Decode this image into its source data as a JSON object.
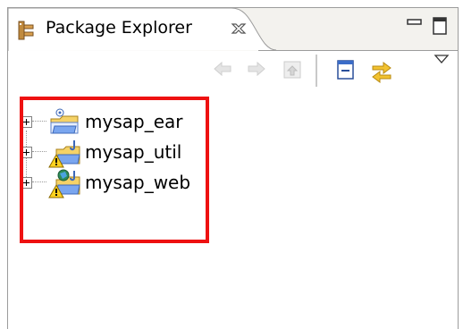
{
  "view": {
    "tab_title": "Package Explorer",
    "tab_icon": "package-explorer-icon",
    "close_icon": "close-tab-icon",
    "minimize_icon": "minimize-icon",
    "maximize_icon": "maximize-icon"
  },
  "toolbar": {
    "items": [
      "back-arrow-icon",
      "forward-arrow-icon",
      "up-folder-icon",
      "collapse-all-icon",
      "link-with-editor-icon",
      "view-menu-icon"
    ]
  },
  "tree": {
    "items": [
      {
        "label": "mysap_ear",
        "icon": "ear-project-icon"
      },
      {
        "label": "mysap_util",
        "icon": "java-project-warning-icon"
      },
      {
        "label": "mysap_web",
        "icon": "web-project-warning-icon"
      }
    ]
  },
  "colors": {
    "highlight": "#ee1111",
    "tab_bg": "#f3f2ee",
    "border": "#9c9c9c"
  }
}
